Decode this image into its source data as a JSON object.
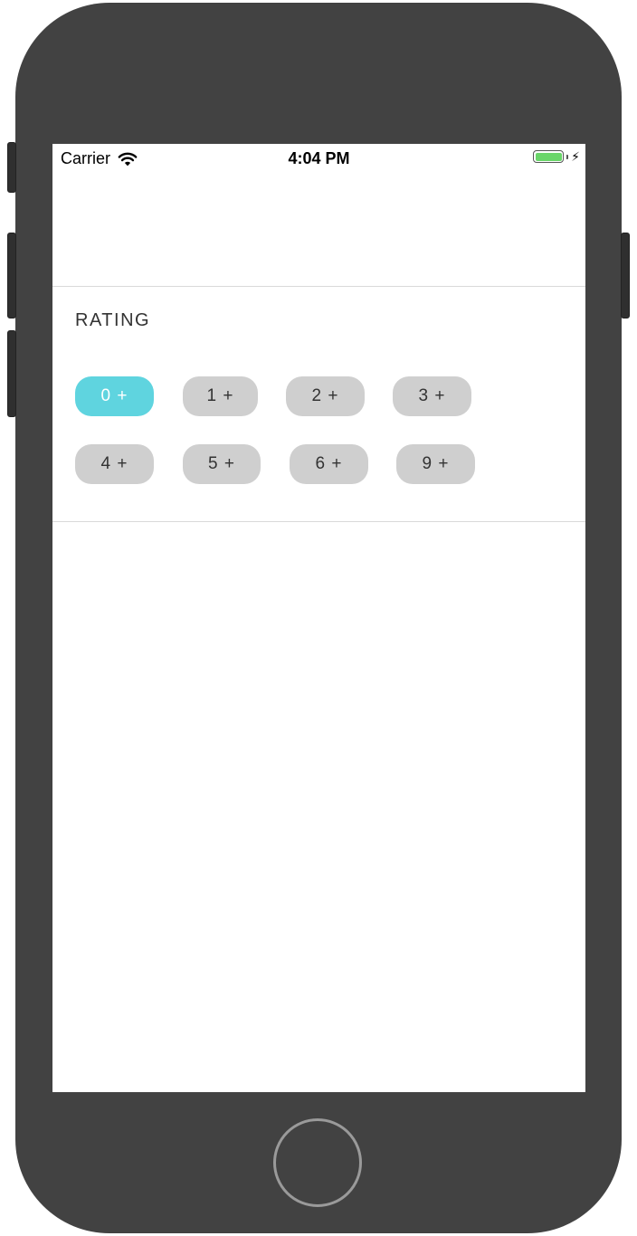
{
  "status_bar": {
    "carrier": "Carrier",
    "time": "4:04 PM",
    "wifi_icon": "wifi-icon",
    "battery_icon": "battery-icon",
    "charging_icon": "bolt-icon",
    "battery_level": 1.0
  },
  "rating": {
    "title": "RATING",
    "options": [
      {
        "label": "0 +",
        "selected": true
      },
      {
        "label": "1 +",
        "selected": false
      },
      {
        "label": "2 +",
        "selected": false
      },
      {
        "label": "3 +",
        "selected": false
      },
      {
        "label": "4 +",
        "selected": false
      },
      {
        "label": "5 +",
        "selected": false
      },
      {
        "label": "6 +",
        "selected": false
      },
      {
        "label": "9 +",
        "selected": false
      }
    ]
  },
  "colors": {
    "accent": "#5fd4df",
    "chip": "#cfcfcf",
    "device": "#424242"
  }
}
